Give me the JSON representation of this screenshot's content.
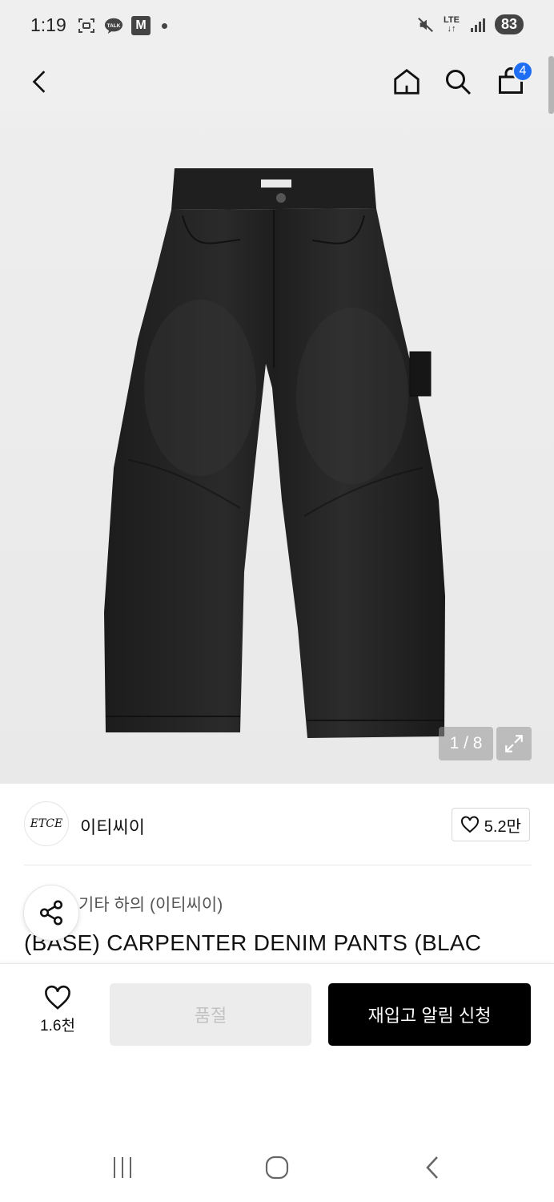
{
  "status_bar": {
    "time": "1:19",
    "left_icons": [
      "screenshot-icon",
      "kakaotalk-icon",
      "m-app-icon",
      "notification-dot-icon"
    ],
    "m_label": "M",
    "talk_label": "TALK",
    "network": "LTE",
    "battery": "83"
  },
  "top_nav": {
    "cart_count": "4",
    "icons": [
      "back-icon",
      "home-icon",
      "search-icon",
      "cart-icon"
    ]
  },
  "product_image": {
    "counter": "1 / 8",
    "description_icon": "jeans-image"
  },
  "brand": {
    "logo_text": "ETCE",
    "name": "이티씨이",
    "likes": "5.2만"
  },
  "product": {
    "category": "기타 하의 (이티씨이)",
    "title": "(BASE) CARPENTER DENIM PANTS (BLAC"
  },
  "action_bar": {
    "wish_count": "1.6천",
    "soldout_label": "품절",
    "restock_label": "재입고 알림 신청"
  },
  "system_nav": {
    "icons": [
      "recent-apps-icon",
      "home-circle-icon",
      "back-chevron-icon"
    ]
  },
  "colors": {
    "accent_badge": "#1e6df5",
    "primary_button": "#000000",
    "disabled_button": "#ececec"
  }
}
